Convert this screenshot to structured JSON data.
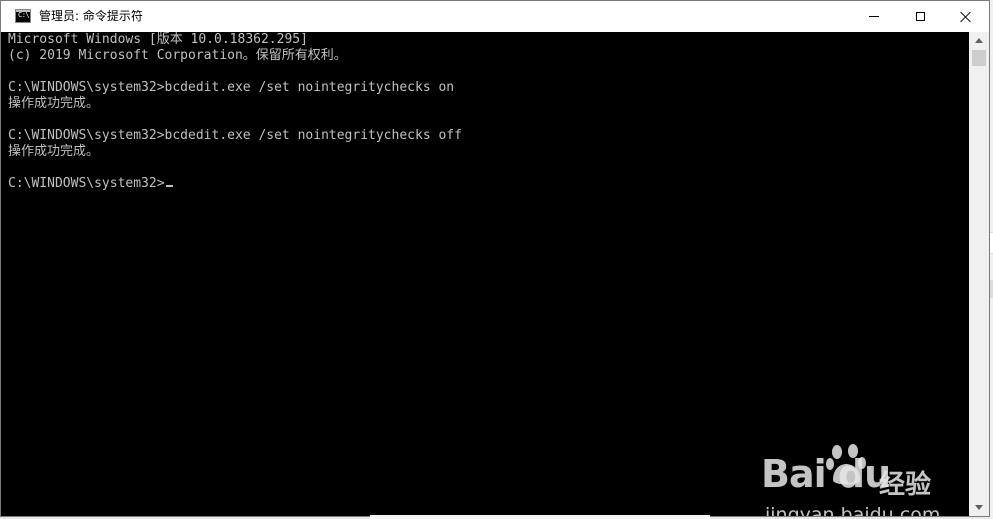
{
  "window": {
    "title": "管理员: 命令提示符",
    "icon": "cmd-icon",
    "icon_text": "C:\\"
  },
  "controls": {
    "minimize": "minimize-icon",
    "maximize": "maximize-icon",
    "close": "close-icon"
  },
  "console": {
    "lines": [
      "Microsoft Windows [版本 10.0.18362.295]",
      "(c) 2019 Microsoft Corporation。保留所有权利。",
      "",
      "C:\\WINDOWS\\system32>bcdedit.exe /set nointegritychecks on",
      "操作成功完成。",
      "",
      "C:\\WINDOWS\\system32>bcdedit.exe /set nointegritychecks off",
      "操作成功完成。",
      "",
      "C:\\WINDOWS\\system32>"
    ],
    "text_color": "#c0c0c0",
    "background": "#000000"
  },
  "watermark": {
    "logo": "Bai du",
    "logo_cn": "经验",
    "url": "jingyan.baidu.com"
  }
}
